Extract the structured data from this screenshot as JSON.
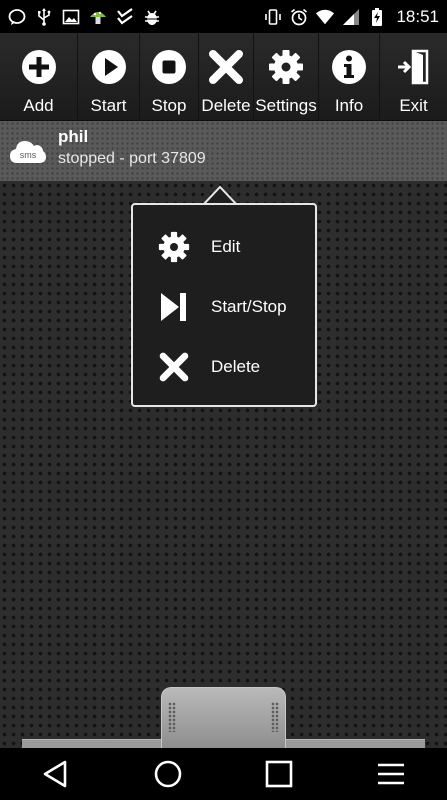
{
  "status_bar": {
    "left_icons": [
      "chat-bubble-icon",
      "usb-icon",
      "image-icon",
      "mushroom-icon",
      "checklist-icon",
      "android-bug-icon"
    ],
    "right_icons": [
      "vibrate-icon",
      "alarm-icon",
      "wifi-icon",
      "signal-icon",
      "battery-charging-icon"
    ],
    "time": "18:51"
  },
  "toolbar": {
    "buttons": [
      {
        "label": "Add",
        "icon": "add-icon"
      },
      {
        "label": "Start",
        "icon": "play-icon"
      },
      {
        "label": "Stop",
        "icon": "stop-icon"
      },
      {
        "label": "Delete",
        "icon": "delete-x-icon"
      },
      {
        "label": "Settings",
        "icon": "gear-icon"
      },
      {
        "label": "Info",
        "icon": "info-icon"
      },
      {
        "label": "Exit",
        "icon": "exit-door-icon"
      }
    ]
  },
  "server": {
    "icon_text": "sms",
    "name": "phil",
    "status": "stopped - port 37809"
  },
  "context_menu": {
    "items": [
      {
        "label": "Edit",
        "icon": "gear-icon"
      },
      {
        "label": "Start/Stop",
        "icon": "play-pause-icon"
      },
      {
        "label": "Delete",
        "icon": "delete-x-icon"
      }
    ]
  },
  "navigation": {
    "buttons": [
      "back-icon",
      "home-icon",
      "recents-icon",
      "menu-icon"
    ]
  },
  "colors": {
    "toolbar_bg": "#1f1f1f",
    "server_row_bg": "#5a5a5a",
    "popup_bg": "#1e1e1e",
    "popup_border": "#e6e6e6"
  }
}
